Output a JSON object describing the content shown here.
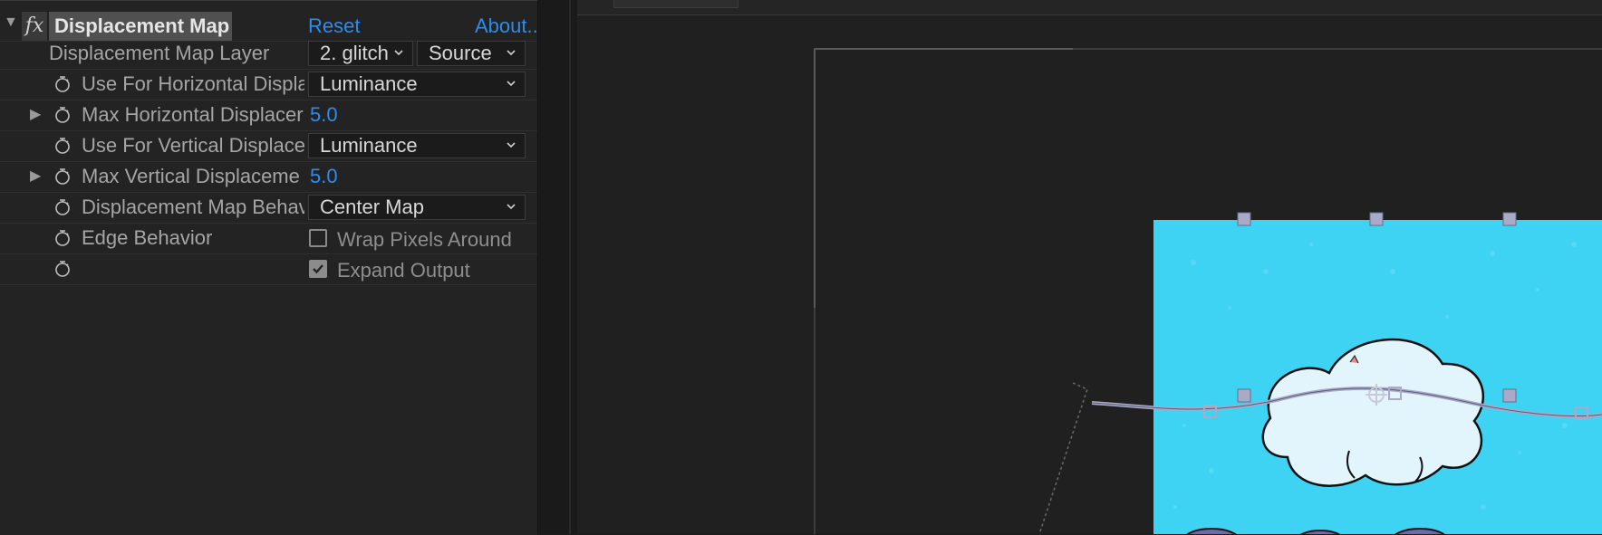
{
  "effect": {
    "name": "Displacement Map",
    "fx_badge": "fx",
    "reset_label": "Reset",
    "about_label": "About..."
  },
  "properties": {
    "map_layer": {
      "label": "Displacement Map Layer",
      "layer_value": "2. glitch",
      "source_value": "Source"
    },
    "use_horizontal": {
      "label": "Use For Horizontal Displa",
      "value": "Luminance"
    },
    "max_horizontal": {
      "label": "Max Horizontal Displacer",
      "value": "5.0"
    },
    "use_vertical": {
      "label": "Use For Vertical Displacer",
      "value": "Luminance"
    },
    "max_vertical": {
      "label": "Max Vertical Displaceme",
      "value": "5.0"
    },
    "map_behavior": {
      "label": "Displacement Map Behav",
      "value": "Center Map"
    },
    "edge_behavior": {
      "label": "Edge Behavior",
      "checkbox_label": "Wrap Pixels Around",
      "checked": false
    },
    "expand_output": {
      "checkbox_label": "Expand Output",
      "checked": true
    }
  },
  "colors": {
    "accent_blue": "#2d8ceb",
    "sky": "#3ed3f2",
    "handle": "#a9a9c8"
  },
  "icons": [
    "twirl-down-icon",
    "twirl-right-icon",
    "stopwatch-icon",
    "chevron-down-icon",
    "checkmark-icon"
  ]
}
